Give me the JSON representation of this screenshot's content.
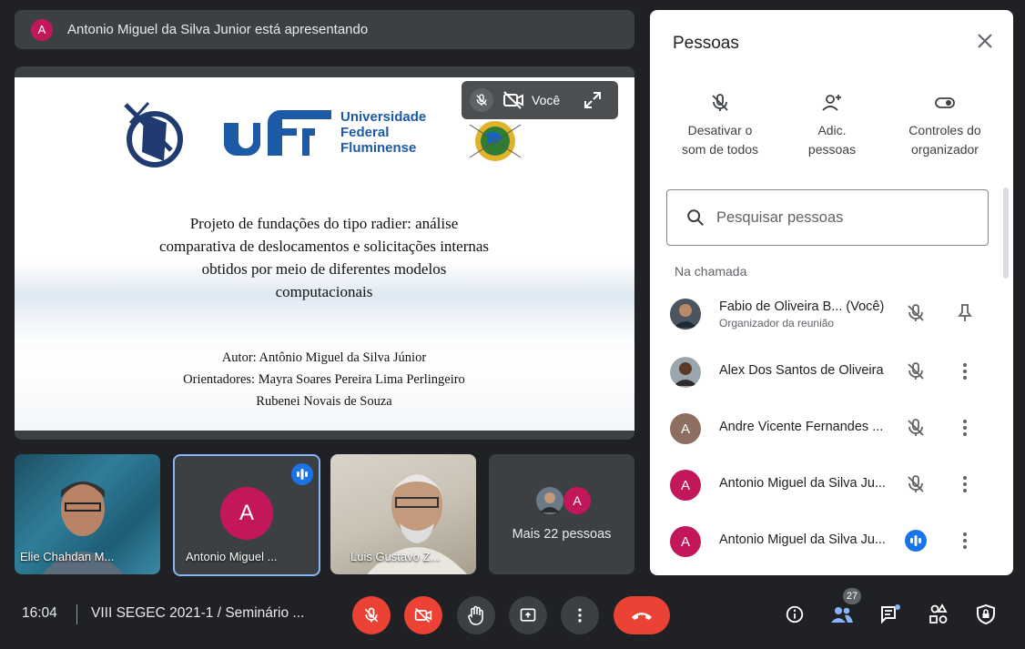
{
  "presenter": {
    "avatar_letter": "A",
    "text": "Antonio Miguel da Silva Junior está apresentando"
  },
  "slide": {
    "uff_line1": "Universidade",
    "uff_line2": "Federal",
    "uff_line3": "Fluminense",
    "title_line1": "Projeto de fundações do tipo radier: análise",
    "title_line2": "comparativa de deslocamentos e solicitações internas",
    "title_line3": "obtidos por meio de diferentes modelos",
    "title_line4": "computacionais",
    "author": "Autor: Antônio Miguel da Silva Júnior",
    "advisors": "Orientadores: Mayra Soares Pereira Lima Perlingeiro",
    "advisor2": "Rubenei Novais de Souza"
  },
  "selfview": {
    "label": "Você"
  },
  "tiles": [
    {
      "name": "Elie Chahdan M..."
    },
    {
      "name": "Antonio Miguel ...",
      "avatar_letter": "A"
    },
    {
      "name": "Luis Gustavo Z..."
    },
    {
      "more": "Mais 22 pessoas",
      "avatar_letter": "A"
    }
  ],
  "panel": {
    "title": "Pessoas",
    "actions": [
      {
        "line1": "Desativar o",
        "line2": "som de todos",
        "icon": "mic-off-icon"
      },
      {
        "line1": "Adic.",
        "line2": "pessoas",
        "icon": "add-person-icon"
      },
      {
        "line1": "Controles do",
        "line2": "organizador",
        "icon": "toggle-icon"
      }
    ],
    "search_placeholder": "Pesquisar pessoas",
    "section": "Na chamada",
    "people": [
      {
        "name": "Fabio de Oliveira B... (Você)",
        "sub": "Organizador da reunião",
        "mic": "muted",
        "action": "pin-icon"
      },
      {
        "name": "Alex Dos Santos de Oliveira",
        "mic": "muted",
        "action": "more-vert-icon"
      },
      {
        "name": "Andre Vicente Fernandes ...",
        "avatar_letter": "A",
        "avatar_color": "#8d6e63",
        "mic": "muted",
        "action": "more-vert-icon"
      },
      {
        "name": "Antonio Miguel da Silva Ju...",
        "avatar_letter": "A",
        "avatar_color": "#c2185b",
        "mic": "muted",
        "action": "more-vert-icon"
      },
      {
        "name": "Antonio Miguel da Silva Ju...",
        "avatar_letter": "A",
        "avatar_color": "#c2185b",
        "mic": "speaking",
        "action": "more-vert-icon"
      }
    ]
  },
  "bottom": {
    "time": "16:04",
    "meeting": "VIII SEGEC 2021-1 / Seminário ...",
    "people_count": "27"
  },
  "colors": {
    "danger": "#ea4335",
    "accent": "#1a73e8",
    "panel_bg": "#ffffff",
    "bg": "#202124"
  }
}
